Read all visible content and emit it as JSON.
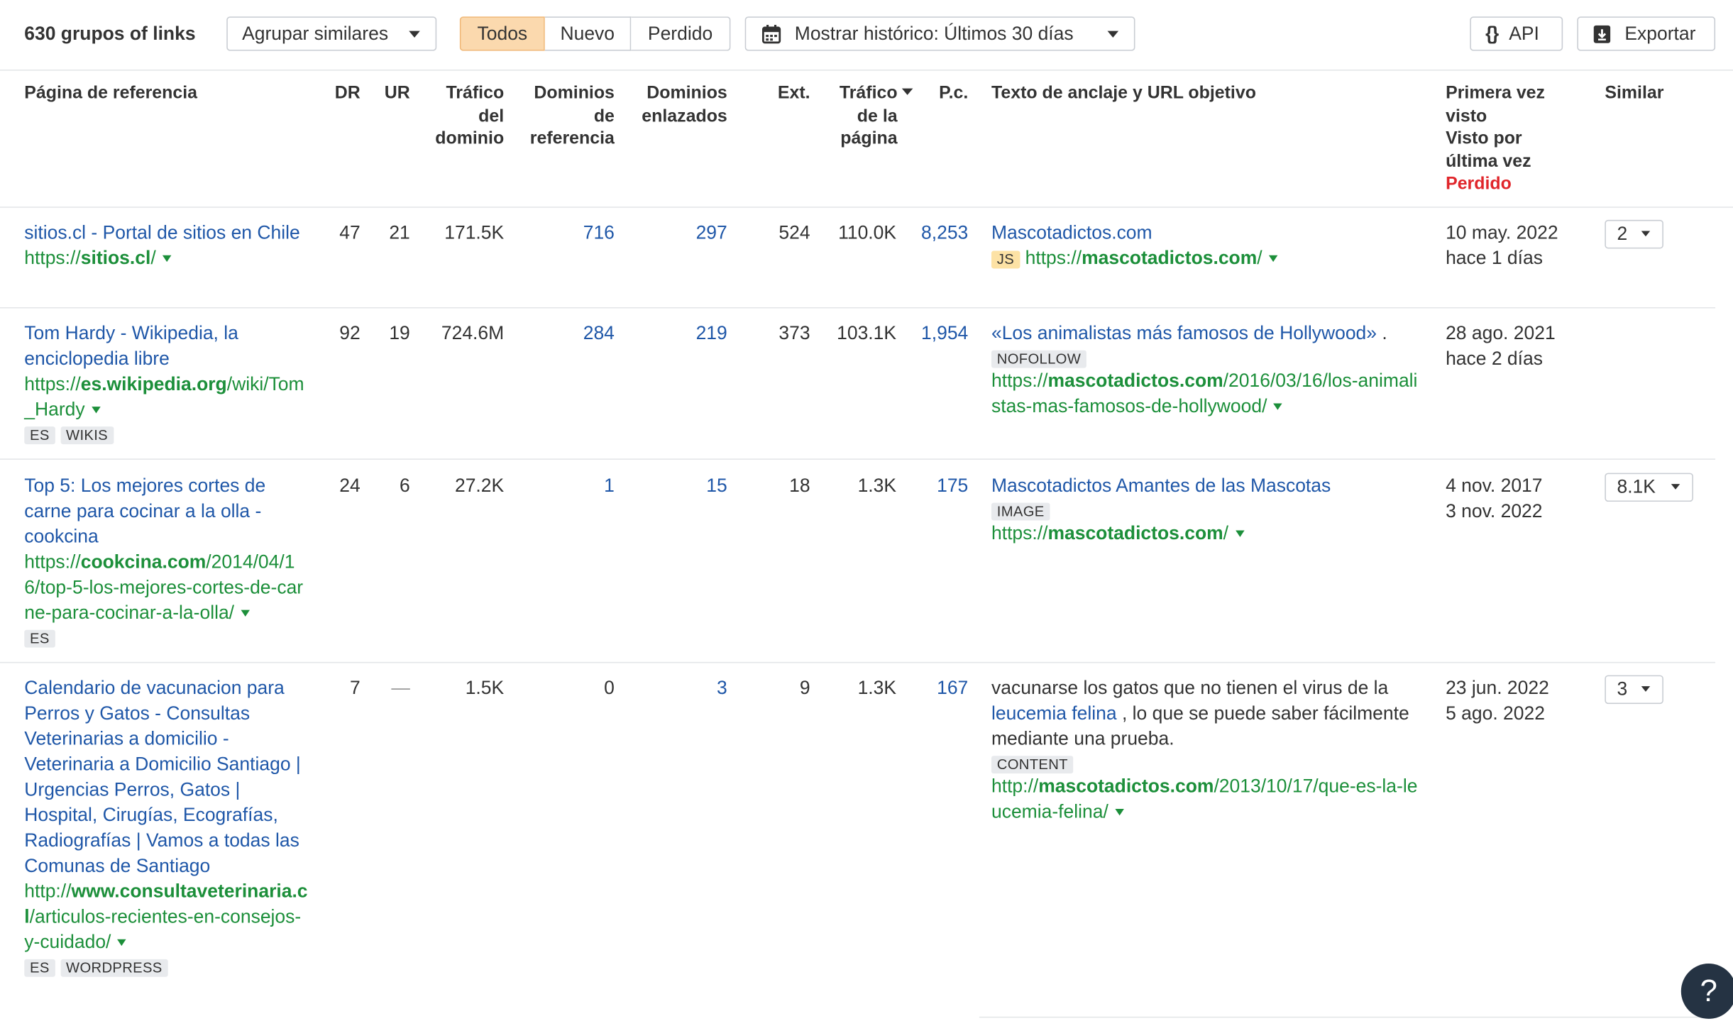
{
  "toolbar": {
    "group_count": "630 grupos of links",
    "group_select": "Agrupar similares",
    "filters": [
      "Todos",
      "Nuevo",
      "Perdido"
    ],
    "history": "Mostrar histórico: Últimos 30 días",
    "api": "API",
    "export": "Exportar"
  },
  "columns": {
    "ref_page": "Página de referencia",
    "dr": "DR",
    "ur": "UR",
    "domain_traffic": [
      "Tráfico",
      "del",
      "dominio"
    ],
    "ref_domains": [
      "Dominios",
      "de",
      "referencia"
    ],
    "linked_domains": [
      "Dominios",
      "enlazados"
    ],
    "ext": "Ext.",
    "page_traffic": [
      "Tráfico",
      "de la",
      "página"
    ],
    "kw": "P.c.",
    "anchor": "Texto de anclaje y URL objetivo",
    "first_seen": [
      "Primera vez",
      "visto"
    ],
    "last_seen": [
      "Visto por",
      "última vez"
    ],
    "lost": "Perdido",
    "similar": "Similar"
  },
  "rows": [
    {
      "title": "sitios.cl - Portal de sitios en Chile",
      "url_prefix": "https://",
      "url_domain": "sitios.cl",
      "url_path": "/",
      "tags": [],
      "dr": "47",
      "ur": "21",
      "domain_traffic": "171.5K",
      "ref_domains": "716",
      "linked_domains": "297",
      "ext": "524",
      "page_traffic": "110.0K",
      "kw": "8,253",
      "anchor": "Mascotadictos.com",
      "anchor_tag": "JS",
      "target_prefix": "https://",
      "target_domain": "mascotadictos.com",
      "target_path": "/",
      "first_seen": "10 may. 2022",
      "last_seen": "hace 1 días",
      "similar": "2"
    },
    {
      "title": "Tom Hardy - Wikipedia, la enciclopedia libre",
      "url_prefix": "https://",
      "url_domain": "es.wikipedia.org",
      "url_path": "/wiki/Tom_Hardy",
      "tags": [
        "ES",
        "WIKIS"
      ],
      "dr": "92",
      "ur": "19",
      "domain_traffic": "724.6M",
      "ref_domains": "284",
      "linked_domains": "219",
      "ext": "373",
      "page_traffic": "103.1K",
      "kw": "1,954",
      "anchor": "«Los animalistas más famosos de Hollywood»",
      "anchor_suffix": " .",
      "anchor_tag": "NOFOLLOW",
      "target_prefix": "https://",
      "target_domain": "mascotadictos.com",
      "target_path": "/2016/03/16/los-animalistas-mas-famosos-de-hollywood/",
      "first_seen": "28 ago. 2021",
      "last_seen": "hace 2 días",
      "similar": ""
    },
    {
      "title": "Top 5: Los mejores cortes de carne para cocinar a la olla - cookcina",
      "url_prefix": "https://",
      "url_domain": "cookcina.com",
      "url_path": "/2014/04/16/top-5-los-mejores-cortes-de-carne-para-cocinar-a-la-olla/",
      "tags": [
        "ES"
      ],
      "dr": "24",
      "ur": "6",
      "domain_traffic": "27.2K",
      "ref_domains": "1",
      "linked_domains": "15",
      "ext": "18",
      "page_traffic": "1.3K",
      "kw": "175",
      "anchor": "Mascotadictos Amantes de las Mascotas",
      "anchor_tag": "IMAGE",
      "target_prefix": "https://",
      "target_domain": "mascotadictos.com",
      "target_path": "/",
      "first_seen": "4 nov. 2017",
      "last_seen": "3 nov. 2022",
      "similar": "8.1K"
    },
    {
      "title": "Calendario de vacunacion para Perros y Gatos - Consultas Veterinarias a domicilio - Veterinaria a Domicilio Santiago | Urgencias Perros, Gatos | Hospital, Cirugías, Ecografías, Radiografías | Vamos a todas las Comunas de Santiago",
      "url_prefix": "http://",
      "url_domain": "www.consultaveterinaria.cl",
      "url_path": "/articulos-recientes-en-consejos-y-cuidado/",
      "tags": [
        "ES",
        "WORDPRESS"
      ],
      "dr": "7",
      "ur": "—",
      "domain_traffic": "1.5K",
      "ref_domains": "0",
      "linked_domains": "3",
      "ext": "9",
      "page_traffic": "1.3K",
      "kw": "167",
      "anchor_before": "vacunarse los gatos que no tienen el virus de la ",
      "anchor": "leucemia felina",
      "anchor_after": " , lo que se puede saber fácilmente mediante una prueba.",
      "anchor_tag": "CONTENT",
      "target_prefix": "http://",
      "target_domain": "mascotadictos.com",
      "target_path": "/2013/10/17/que-es-la-leucemia-felina/",
      "first_seen": "23 jun. 2022",
      "last_seen": "5 ago. 2022",
      "similar": "3"
    }
  ],
  "help": "?",
  "colors": {
    "link": "#1f57a8",
    "url": "#1c8f3a",
    "lost": "#e0262b",
    "active_filter": "#fbd9ae"
  }
}
